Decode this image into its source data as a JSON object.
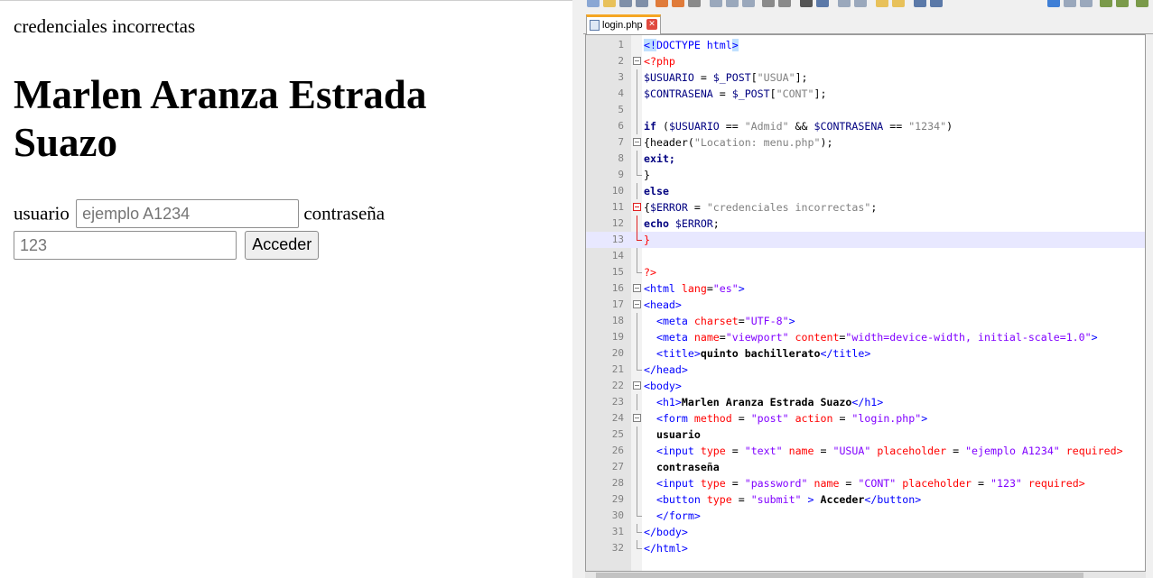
{
  "browser": {
    "message": "credenciales incorrectas",
    "heading": "Marlen Aranza Estrada Suazo",
    "form": {
      "user_label": "usuario",
      "user_placeholder": "ejemplo A1234",
      "pass_label": "contraseña",
      "pass_placeholder": "123",
      "submit_label": "Acceder"
    }
  },
  "editor": {
    "tab_name": "login.php",
    "current_line": 13,
    "line_numbers": [
      "1",
      "2",
      "3",
      "4",
      "5",
      "6",
      "7",
      "8",
      "9",
      "10",
      "11",
      "12",
      "13",
      "14",
      "15",
      "16",
      "17",
      "18",
      "19",
      "20",
      "21",
      "22",
      "23",
      "24",
      "25",
      "26",
      "27",
      "28",
      "29",
      "30",
      "31",
      "32"
    ],
    "code": {
      "l1_a": "<!",
      "l1_b": "DOCTYPE html",
      "l1_c": ">",
      "l2": "<?php",
      "l3_a": "$USUARIO",
      "l3_b": " = ",
      "l3_c": "$_POST",
      "l3_d": "[",
      "l3_e": "\"USUA\"",
      "l3_f": "];",
      "l4_a": "$CONTRASENA",
      "l4_b": " = ",
      "l4_c": "$_POST",
      "l4_d": "[",
      "l4_e": "\"CONT\"",
      "l4_f": "];",
      "l6_a": "if",
      "l6_b": " (",
      "l6_c": "$USUARIO",
      "l6_d": " == ",
      "l6_e": "\"Admid\"",
      "l6_f": " && ",
      "l6_g": "$CONTRASENA",
      "l6_h": " == ",
      "l6_i": "\"1234\"",
      "l6_j": ")",
      "l7_a": "{",
      "l7_b": "header",
      "l7_c": "(",
      "l7_d": "\"Location: menu.php\"",
      "l7_e": ");",
      "l8": "exit;",
      "l9": "}",
      "l10": "else",
      "l11_a": "{",
      "l11_b": "$ERROR",
      "l11_c": " = ",
      "l11_d": "\"credenciales incorrectas\"",
      "l11_e": ";",
      "l12_a": "echo",
      "l12_b": " ",
      "l12_c": "$ERROR",
      "l12_d": ";",
      "l13": "}",
      "l15": "?>",
      "l16_a": "<html ",
      "l16_b": "lang",
      "l16_c": "=",
      "l16_d": "\"es\"",
      "l16_e": ">",
      "l17": "<head>",
      "l18_a": "<meta ",
      "l18_b": "charset",
      "l18_c": "=",
      "l18_d": "\"UTF-8\"",
      "l18_e": ">",
      "l19_a": "<meta ",
      "l19_b": "name",
      "l19_c": "=",
      "l19_d": "\"viewport\"",
      "l19_e": " content",
      "l19_f": "=",
      "l19_g": "\"width=device-width, initial-scale=1.0\"",
      "l19_h": ">",
      "l20_a": "<title>",
      "l20_b": "quinto bachillerato",
      "l20_c": "</title>",
      "l21": "</head>",
      "l22": "<body>",
      "l23_a": "<h1>",
      "l23_b": "Marlen Aranza Estrada Suazo",
      "l23_c": "</h1>",
      "l24_a": "<form ",
      "l24_b": "method",
      "l24_c": " = ",
      "l24_d": "\"post\"",
      "l24_e": " action",
      "l24_f": " = ",
      "l24_g": "\"login.php\"",
      "l24_h": ">",
      "l25": "usuario",
      "l26_a": "<input ",
      "l26_b": "type",
      "l26_c": " = ",
      "l26_d": "\"text\"",
      "l26_e": " name",
      "l26_f": " = ",
      "l26_g": "\"USUA\"",
      "l26_h": " placeholder",
      "l26_i": " = ",
      "l26_j": "\"ejemplo A1234\"",
      "l26_k": " required>",
      "l27": "contraseña",
      "l28_a": "<input ",
      "l28_b": "type",
      "l28_c": " = ",
      "l28_d": "\"password\"",
      "l28_e": " name",
      "l28_f": " = ",
      "l28_g": "\"CONT\"",
      "l28_h": " placeholder",
      "l28_i": " = ",
      "l28_j": "\"123\"",
      "l28_k": " required>",
      "l29_a": "<button ",
      "l29_b": "type",
      "l29_c": " = ",
      "l29_d": "\"submit\"",
      "l29_e": " > ",
      "l29_f": "Acceder",
      "l29_g": "</button>",
      "l30": "</form>",
      "l31": "</body>",
      "l32": "</html>"
    }
  },
  "colors": {
    "tag": "#0000ff",
    "attribute": "#ff0000",
    "attr_value": "#8000ff",
    "php_var": "#000080",
    "php_string": "#808080",
    "php_delim": "#ff0000",
    "tab_accent": "#f5a623",
    "current_line": "#e8e8ff"
  }
}
